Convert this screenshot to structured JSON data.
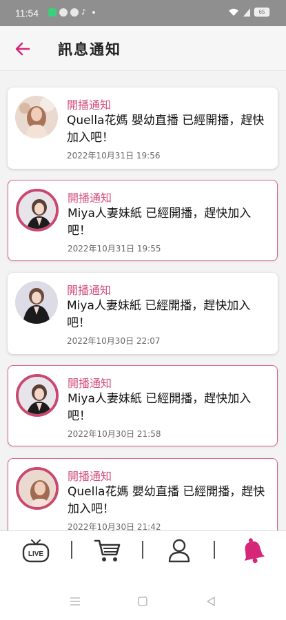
{
  "status_bar": {
    "time": "11:54",
    "battery": "65"
  },
  "header": {
    "title": "訊息通知"
  },
  "notifications": [
    {
      "label": "開播通知",
      "message": "Quella花媽 嬰幼直播 已經開播，趕快加入吧！",
      "time": "2022年10月31日 19:56",
      "highlighted": false,
      "avatar": "quella-avatar"
    },
    {
      "label": "開播通知",
      "message": "Miya人妻妹紙 已經開播，趕快加入吧！",
      "time": "2022年10月31日 19:55",
      "highlighted": true,
      "avatar": "miya-avatar"
    },
    {
      "label": "開播通知",
      "message": "Miya人妻妹紙 已經開播，趕快加入吧！",
      "time": "2022年10月30日 22:07",
      "highlighted": false,
      "avatar": "miya-avatar"
    },
    {
      "label": "開播通知",
      "message": "Miya人妻妹紙 已經開播，趕快加入吧！",
      "time": "2022年10月30日 21:58",
      "highlighted": true,
      "avatar": "miya-avatar"
    },
    {
      "label": "開播通知",
      "message": "Quella花媽 嬰幼直播 已經開播，趕快加入吧！",
      "time": "2022年10月30日 21:42",
      "highlighted": true,
      "avatar": "quella-avatar"
    }
  ],
  "bottom_nav": {
    "items": [
      {
        "icon": "live-tv-icon",
        "text": "LIVE",
        "active": false
      },
      {
        "icon": "cart-icon",
        "active": false
      },
      {
        "icon": "profile-icon",
        "active": false
      },
      {
        "icon": "bell-icon",
        "active": true
      }
    ]
  },
  "colors": {
    "accent": "#d6267a",
    "label": "#d24f7b",
    "highlight_border": "#d8638a"
  }
}
